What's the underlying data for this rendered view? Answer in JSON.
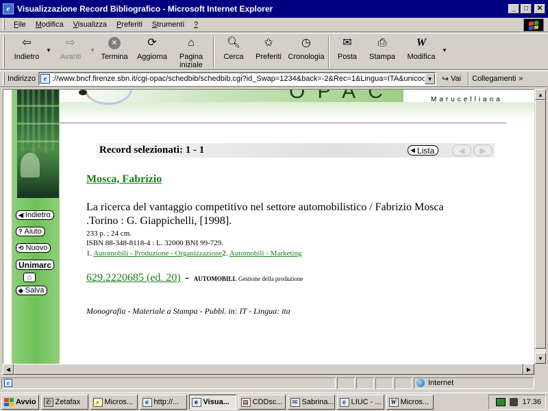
{
  "window": {
    "title": "Visualizzazione Record Bibliografico - Microsoft Internet Explorer",
    "buttons": {
      "minimize": "_",
      "maximize": "□",
      "close": "✕"
    }
  },
  "menubar": {
    "items": [
      {
        "label": "File",
        "accel": "F",
        "rest": "ile"
      },
      {
        "label": "Modifica",
        "accel": "M",
        "rest": "odifica"
      },
      {
        "label": "Visualizza",
        "accel": "V",
        "rest": "isualizza"
      },
      {
        "label": "Preferiti",
        "accel": "P",
        "rest": "referiti"
      },
      {
        "label": "Strumenti",
        "accel": "S",
        "rest": "trumenti"
      },
      {
        "label": "?",
        "accel": "?",
        "rest": ""
      }
    ]
  },
  "toolbar": {
    "back": "Indietro",
    "forward": "Avanti",
    "stop": "Termina",
    "refresh": "Aggiorna",
    "home_line1": "Pagina",
    "home_line2": "iniziale",
    "search": "Cerca",
    "favorites": "Preferiti",
    "history": "Cronologia",
    "mail": "Posta",
    "print": "Stampa",
    "edit": "Modifica"
  },
  "addressbar": {
    "label": "Indirizzo",
    "url": "://www.bncf.firenze.sbn.it/cgi-opac/schedbib/schedbib.cgi?id_Swap=1234&back=-2&Rec=1&Lingua=ITA&unicode=F",
    "go_label": "Vai",
    "links_label": "Collegamenti"
  },
  "banner": {
    "opac_text": "OPAC",
    "library_name": "Marucelliana"
  },
  "leftnav": {
    "back": "Indietro",
    "help": "Aiuto",
    "new": "Nuovo",
    "unimarc": "Unimarc",
    "save": "Salva"
  },
  "record": {
    "selected_label": "Record selezionati: 1 - 1",
    "list_button": "Lista",
    "author": "Mosca, Fabrizio",
    "title_line": "La ricerca del vantaggio competitivo nel settore automobilistico / Fabrizio Mosca .Torino : G. Giappichelli, [1998].",
    "physical": "233 p. ; 24 cm.",
    "isbn": "ISBN 88-348-8118-4 : L. 32000 BNI 99-729.",
    "subjects": [
      {
        "num": "1. ",
        "label": "Automobili - Produzione - Organizzazione"
      },
      {
        "num": "2. ",
        "label": "Automobili - Marketing"
      }
    ],
    "classification_code": "629.2220685 (ed. 20)",
    "classification_dash": "-",
    "classification_head": "AUTOMOBILI.",
    "classification_desc": "Gestione della produzione",
    "footer": "Monografia - Materiale a Stampa - Pubbl. in: IT - Lingua: ita"
  },
  "statusbar": {
    "zone": "Internet"
  },
  "taskbar": {
    "start": "Avvio",
    "tasks": [
      "Zetafax",
      "Micros...",
      "http://...",
      "Visua...",
      "CDDsc...",
      "Sabrina...",
      "LIUC - ...",
      "Micros..."
    ],
    "clock": "17.36"
  }
}
